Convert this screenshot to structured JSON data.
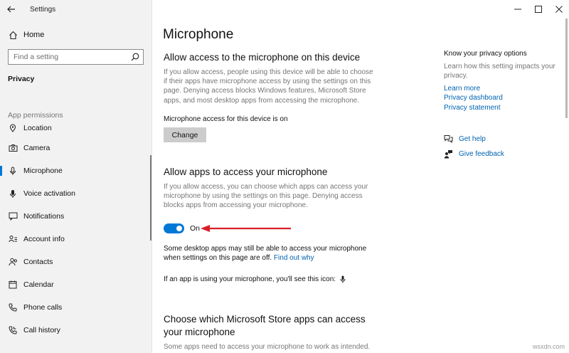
{
  "window": {
    "title": "Settings",
    "controls": [
      "minimize",
      "maximize",
      "close"
    ]
  },
  "sidebar": {
    "home_label": "Home",
    "search_placeholder": "Find a setting",
    "category": "Privacy",
    "section_label": "App permissions",
    "items": [
      {
        "label": "Location",
        "icon": "location-icon"
      },
      {
        "label": "Camera",
        "icon": "camera-icon"
      },
      {
        "label": "Microphone",
        "icon": "microphone-icon",
        "active": true
      },
      {
        "label": "Voice activation",
        "icon": "voice-activation-icon"
      },
      {
        "label": "Notifications",
        "icon": "notifications-icon"
      },
      {
        "label": "Account info",
        "icon": "account-info-icon"
      },
      {
        "label": "Contacts",
        "icon": "contacts-icon"
      },
      {
        "label": "Calendar",
        "icon": "calendar-icon"
      },
      {
        "label": "Phone calls",
        "icon": "phone-calls-icon"
      },
      {
        "label": "Call history",
        "icon": "call-history-icon"
      }
    ]
  },
  "main": {
    "title": "Microphone",
    "section1": {
      "heading": "Allow access to the microphone on this device",
      "description": "If you allow access, people using this device will be able to choose if their apps have microphone access by using the settings on this page. Denying access blocks Windows features, Microsoft Store apps, and most desktop apps from accessing the microphone.",
      "status": "Microphone access for this device is on",
      "change_button": "Change"
    },
    "section2": {
      "heading": "Allow apps to access your microphone",
      "description": "If you allow access, you can choose which apps can access your microphone by using the settings on this page. Denying access blocks apps from accessing your microphone.",
      "toggle_state": "On",
      "toggle_on": true,
      "note_text": "Some desktop apps may still be able to access your microphone when settings on this page are off.",
      "note_link": "Find out why",
      "icon_text": "If an app is using your microphone, you'll see this icon:"
    },
    "section3": {
      "heading": "Choose which Microsoft Store apps can access your microphone",
      "description": "Some apps need to access your microphone to work as intended."
    }
  },
  "right": {
    "title": "Know your privacy options",
    "description": "Learn how this setting impacts your privacy.",
    "links": [
      "Learn more",
      "Privacy dashboard",
      "Privacy statement"
    ],
    "get_help": "Get help",
    "give_feedback": "Give feedback"
  },
  "watermark": "wsxdn.com",
  "colors": {
    "accent": "#0078d7",
    "link": "#0063b1",
    "arrow": "#d91f26",
    "sidebar_bg": "#f2f2f2"
  }
}
